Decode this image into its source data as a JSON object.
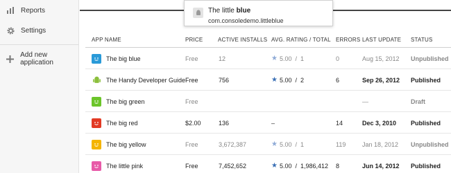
{
  "sidebar": {
    "items": [
      {
        "label": "Reports",
        "icon": "chart-icon"
      },
      {
        "label": "Settings",
        "icon": "gear-icon"
      },
      {
        "label": "Add new application",
        "icon": "plus-icon"
      }
    ]
  },
  "tooltip": {
    "title_prefix": "The little",
    "title_bold": "blue",
    "package": "com.consoledemo.littleblue"
  },
  "table": {
    "headers": [
      "APP NAME",
      "PRICE",
      "ACTIVE INSTALLS",
      "AVG. RATING / TOTAL",
      "ERRORS",
      "LAST UPDATE",
      "STATUS"
    ],
    "rows": [
      {
        "icon_color": "#2a9ad8",
        "icon": "android-face-icon",
        "name": "The big blue",
        "price": "Free",
        "installs": "12",
        "rating": "5.00",
        "total": "1",
        "errors": "0",
        "updated": "Aug 15, 2012",
        "status": "Unpublished",
        "published": false,
        "starred": true
      },
      {
        "icon_color": "#ffffff",
        "icon": "android-robot-icon",
        "name": "The Handy Developer Guide",
        "price": "Free",
        "installs": "756",
        "rating": "5.00",
        "total": "2",
        "errors": "6",
        "updated": "Sep 26, 2012",
        "status": "Published",
        "published": true,
        "starred": true
      },
      {
        "icon_color": "#6cc52a",
        "icon": "android-face-icon",
        "name": "The big green",
        "price": "Free",
        "installs": "",
        "rating": "",
        "total": "",
        "errors": "",
        "updated": "—",
        "status": "Draft",
        "published": false,
        "starred": false
      },
      {
        "icon_color": "#e23a24",
        "icon": "android-face-icon",
        "name": "The big red",
        "price": "$2.00",
        "installs": "136",
        "rating": "–",
        "total": "",
        "errors": "14",
        "updated": "Dec 3, 2010",
        "status": "Published",
        "published": true,
        "starred": false
      },
      {
        "icon_color": "#f4b400",
        "icon": "android-face-icon",
        "name": "The big yellow",
        "price": "Free",
        "installs": "3,672,387",
        "rating": "5.00",
        "total": "1",
        "errors": "119",
        "updated": "Jan 18, 2012",
        "status": "Unpublished",
        "published": false,
        "starred": true
      },
      {
        "icon_color": "#e85aa8",
        "icon": "android-face-icon",
        "name": "The little pink",
        "price": "Free",
        "installs": "7,452,652",
        "rating": "5.00",
        "total": "1,986,412",
        "errors": "8",
        "updated": "Jun 14, 2012",
        "status": "Published",
        "published": true,
        "starred": true
      }
    ]
  }
}
